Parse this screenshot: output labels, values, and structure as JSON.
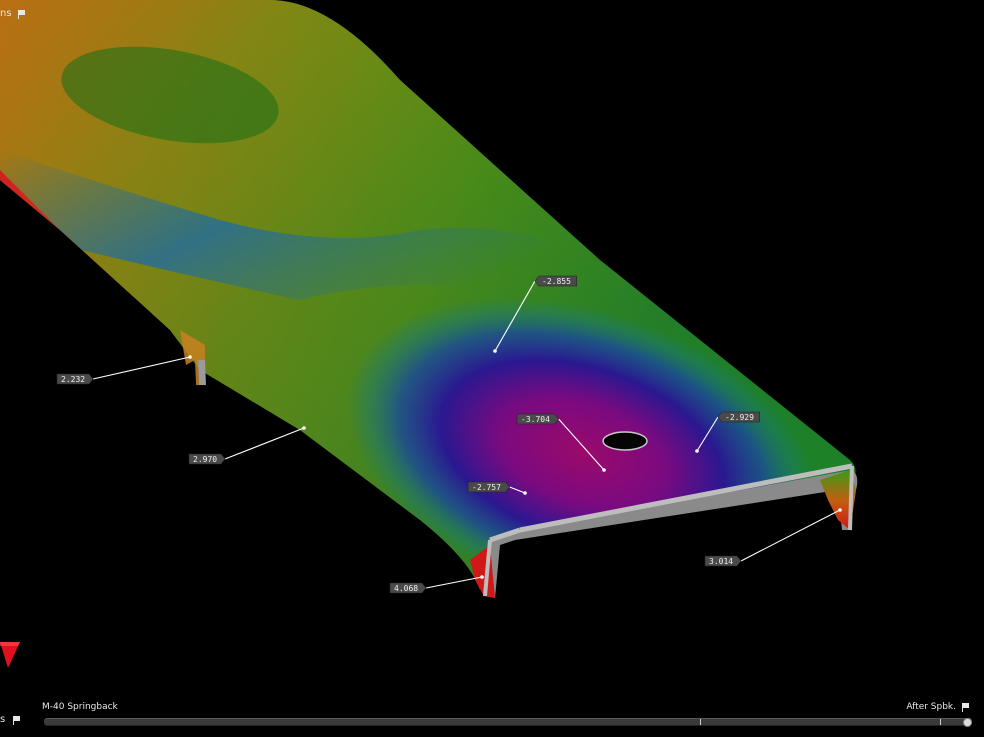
{
  "window": {
    "top_label": "ns",
    "bottom_left_label": "s"
  },
  "timeline": {
    "left_label": "M-40 Springback",
    "right_label": "After Spbk."
  },
  "callouts": [
    {
      "id": "c1",
      "value": "-2.855"
    },
    {
      "id": "c2",
      "value": "2.232"
    },
    {
      "id": "c3",
      "value": "-3.704"
    },
    {
      "id": "c4",
      "value": "-2.929"
    },
    {
      "id": "c5",
      "value": "2.970"
    },
    {
      "id": "c6",
      "value": "-2.757"
    },
    {
      "id": "c7",
      "value": "3.014"
    },
    {
      "id": "c8",
      "value": "4.068"
    }
  ],
  "colors": {
    "background": "#000000",
    "callout_bg": "#4a4a4a",
    "callout_text": "#f0f0f0",
    "leader_line": "#ffffff",
    "max_red": "#e0101e",
    "min_magenta": "#8a0a6e"
  },
  "icons": {
    "top_label_icon": "flag-icon",
    "bottom_left_icon": "flag-icon",
    "right_label_icon": "flag-icon"
  }
}
